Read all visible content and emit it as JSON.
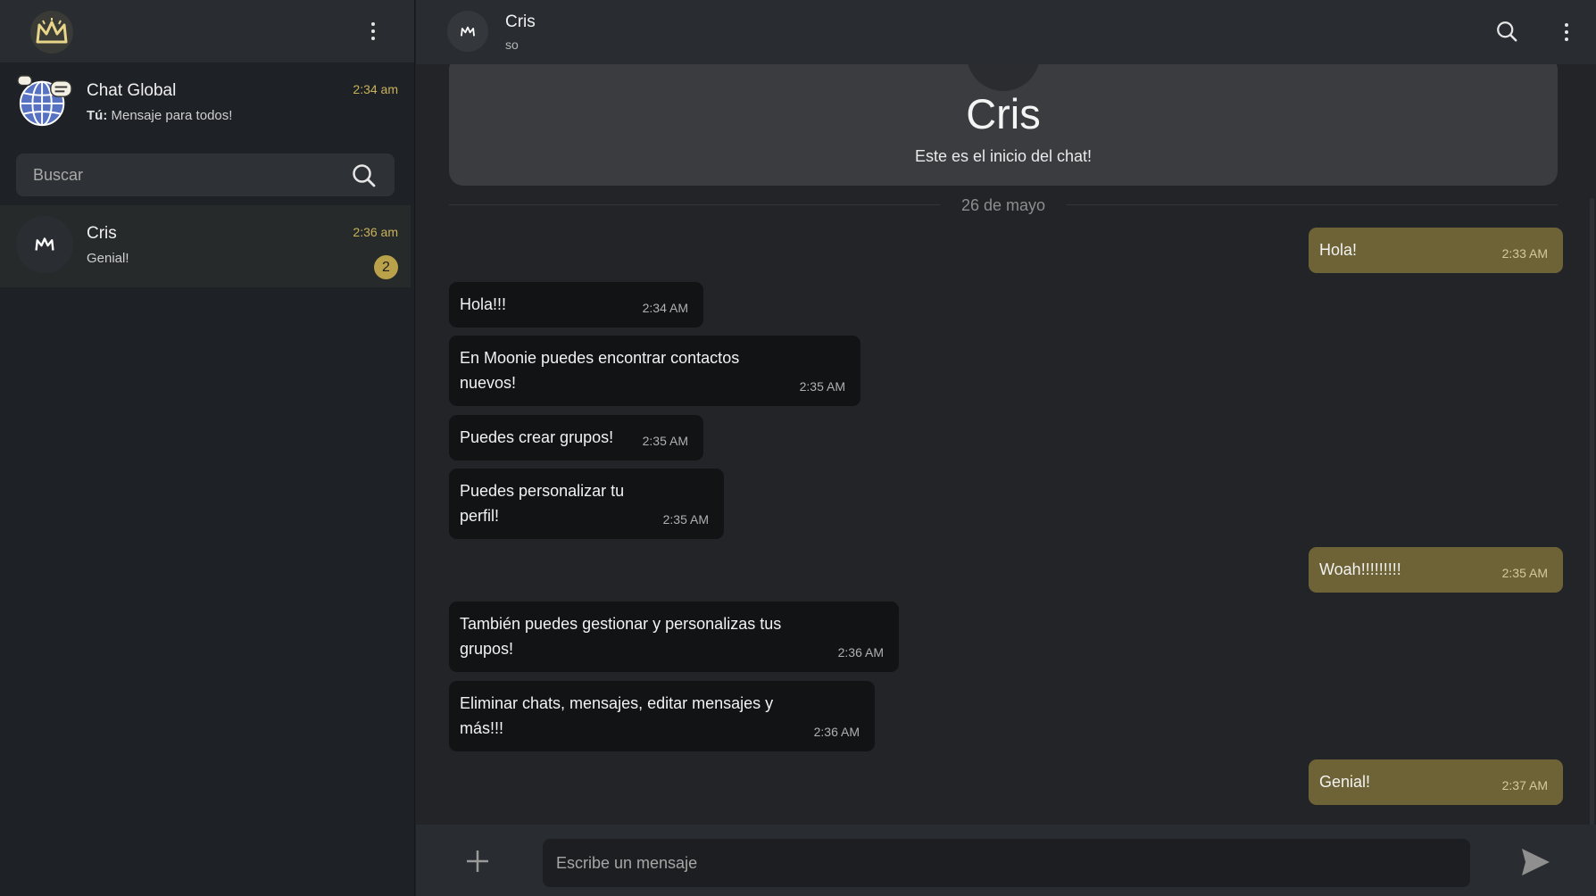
{
  "sidebar": {
    "search_placeholder": "Buscar",
    "chats": [
      {
        "name": "Chat Global",
        "sender": "Tú:",
        "preview": "Mensaje para todos!",
        "time": "2:34 am"
      },
      {
        "name": "Cris",
        "preview": "Genial!",
        "time": "2:36 am",
        "unread": "2"
      }
    ]
  },
  "header": {
    "name": "Cris",
    "status": "so"
  },
  "intro": {
    "name": "Cris",
    "subtitle": "Este es el inicio del chat!"
  },
  "date_separator": "26 de mayo",
  "messages": [
    {
      "direction": "out",
      "text": "Hola!",
      "time": "2:33 AM"
    },
    {
      "direction": "in",
      "text": "Hola!!!",
      "time": "2:34 AM"
    },
    {
      "direction": "in",
      "text": "En Moonie puedes encontrar contactos nuevos!",
      "time": "2:35 AM"
    },
    {
      "direction": "in",
      "text": "Puedes crear grupos!",
      "time": "2:35 AM"
    },
    {
      "direction": "in",
      "text": "Puedes personalizar tu perfil!",
      "time": "2:35 AM"
    },
    {
      "direction": "out",
      "text": "Woah!!!!!!!!!",
      "time": "2:35 AM"
    },
    {
      "direction": "in",
      "text": "También puedes gestionar y personalizas tus grupos!",
      "time": "2:36 AM"
    },
    {
      "direction": "in",
      "text": "Eliminar chats, mensajes, editar mensajes y más!!!",
      "time": "2:36 AM"
    },
    {
      "direction": "out",
      "text": "Genial!",
      "time": "2:37 AM"
    }
  ],
  "composer": {
    "placeholder": "Escribe un mensaje"
  },
  "colors": {
    "accent": "#c9b25a",
    "outgoing_bubble": "#6e6337",
    "incoming_bubble": "#121315"
  },
  "icons": {
    "app_logo": "moonie-crown-logo",
    "menu": "kebab-menu-icon",
    "search": "search-icon",
    "attach": "plus-icon",
    "send": "send-icon"
  }
}
